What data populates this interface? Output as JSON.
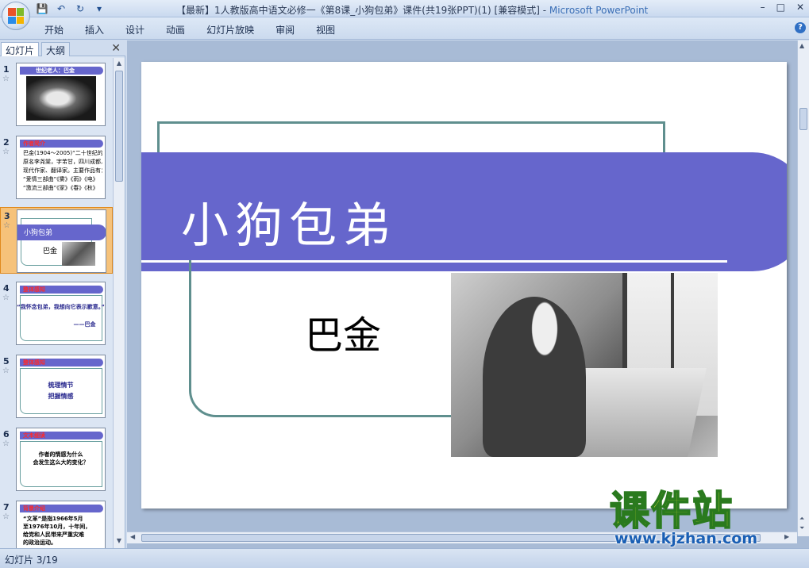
{
  "window": {
    "title": "【最新】1人教版高中语文必修一《第8课_小狗包弟》课件(共19张PPT)(1) [兼容模式]",
    "app_name": "Microsoft PowerPoint",
    "minimize": "–",
    "restore": "□",
    "close": "✕"
  },
  "ribbon": {
    "tabs": [
      "开始",
      "插入",
      "设计",
      "动画",
      "幻灯片放映",
      "审阅",
      "视图"
    ]
  },
  "panel": {
    "tab_slides": "幻灯片",
    "tab_outline": "大纲",
    "close": "✕",
    "thumbnails": [
      {
        "num": "1",
        "band_label": "世纪老人：巴金",
        "lines": []
      },
      {
        "num": "2",
        "band_label": "作者简介",
        "lines": [
          "巴金(1904～2005)“二十世纪的良心”",
          "原名李尧棠，字芾甘，四川成都人。",
          "现代作家、翻译家。主要作品有：",
          "“爱情三部曲”《雾》《雨》《电》",
          "“激流三部曲”《家》《春》《秋》"
        ]
      },
      {
        "num": "3",
        "band_label": "小狗包弟",
        "lines": [
          "巴金"
        ]
      },
      {
        "num": "4",
        "band_label": "整体感知",
        "lines": [
          "“我怀念包弟，我想向它表示歉意。”",
          "——巴金"
        ]
      },
      {
        "num": "5",
        "band_label": "整体感知",
        "lines": [
          "梳理情节",
          "把握情感"
        ]
      },
      {
        "num": "6",
        "band_label": "文本细读",
        "lines": [
          "作者的情感为什么",
          "会发生这么大的变化？"
        ]
      },
      {
        "num": "7",
        "band_label": "背景介绍",
        "lines": [
          "“文革”是指1966年5月",
          "至1976年10月，十年间，",
          "给党和人民带来严重灾难",
          "的政治运动。"
        ]
      }
    ]
  },
  "slide": {
    "title": "小狗包弟",
    "author": "巴金"
  },
  "status": {
    "slide_indicator": "幻灯片 3/19"
  },
  "watermark": {
    "brand": "课件站",
    "url": "www.kjzhan.com"
  },
  "colors": {
    "band": "#6666cc",
    "frame": "#5f8f8e",
    "selected_thumb": "#f6c27a"
  }
}
